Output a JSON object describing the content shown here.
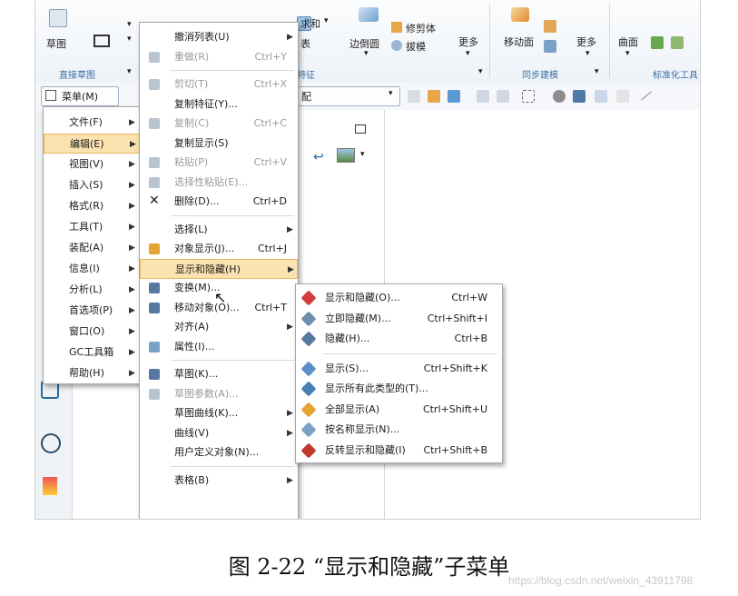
{
  "ribbon": {
    "sketch_label": "草图",
    "direct_sketch_label": "直接草图",
    "sum_label": "求和",
    "sum_sub": "表",
    "edge_label": "边倒圆",
    "trim_label": "修剪体",
    "draft_label": "拔模",
    "more1_label": "更多",
    "move_face_label": "移动面",
    "more2_label": "更多",
    "surface_label": "曲面",
    "feature_group": "特征",
    "sync_group": "同步建模",
    "std_group": "标准化工具"
  },
  "toolbar": {
    "menu_label": "菜单(M)",
    "assembly_combo": "配"
  },
  "main_menu": [
    {
      "label": "文件(F)"
    },
    {
      "label": "编辑(E)",
      "active": true
    },
    {
      "label": "视图(V)"
    },
    {
      "label": "插入(S)"
    },
    {
      "label": "格式(R)"
    },
    {
      "label": "工具(T)"
    },
    {
      "label": "装配(A)"
    },
    {
      "label": "信息(I)"
    },
    {
      "label": "分析(L)"
    },
    {
      "label": "首选项(P)"
    },
    {
      "label": "窗口(O)"
    },
    {
      "label": "GC工具箱"
    },
    {
      "label": "帮助(H)"
    }
  ],
  "edit_menu": [
    {
      "label": "撤消列表(U)",
      "shortcut": "",
      "submenu": true,
      "disabled": false
    },
    {
      "label": "重做(R)",
      "shortcut": "Ctrl+Y",
      "submenu": false,
      "disabled": true
    },
    {
      "sep": true
    },
    {
      "label": "剪切(T)",
      "shortcut": "Ctrl+X",
      "submenu": false,
      "disabled": true
    },
    {
      "label": "复制特征(Y)...",
      "shortcut": "",
      "submenu": false,
      "disabled": false
    },
    {
      "label": "复制(C)",
      "shortcut": "Ctrl+C",
      "submenu": false,
      "disabled": true
    },
    {
      "label": "复制显示(S)",
      "shortcut": "",
      "submenu": false,
      "disabled": false
    },
    {
      "label": "粘贴(P)",
      "shortcut": "Ctrl+V",
      "submenu": false,
      "disabled": true
    },
    {
      "label": "选择性粘贴(E)...",
      "shortcut": "",
      "submenu": false,
      "disabled": true
    },
    {
      "label": "删除(D)...",
      "shortcut": "Ctrl+D",
      "submenu": false,
      "disabled": false
    },
    {
      "sep": true
    },
    {
      "label": "选择(L)",
      "shortcut": "",
      "submenu": true,
      "disabled": false
    },
    {
      "label": "对象显示(J)...",
      "shortcut": "Ctrl+J",
      "submenu": false,
      "disabled": false
    },
    {
      "label": "显示和隐藏(H)",
      "shortcut": "",
      "submenu": true,
      "disabled": false,
      "active": true
    },
    {
      "label": "变换(M)...",
      "shortcut": "",
      "submenu": false,
      "disabled": false
    },
    {
      "label": "移动对象(O)...",
      "shortcut": "Ctrl+T",
      "submenu": false,
      "disabled": false
    },
    {
      "label": "对齐(A)",
      "shortcut": "",
      "submenu": true,
      "disabled": false
    },
    {
      "label": "属性(I)...",
      "shortcut": "",
      "submenu": false,
      "disabled": false
    },
    {
      "sep": true
    },
    {
      "label": "草图(K)...",
      "shortcut": "",
      "submenu": false,
      "disabled": false
    },
    {
      "label": "草图参数(A)...",
      "shortcut": "",
      "submenu": false,
      "disabled": true
    },
    {
      "label": "草图曲线(K)...",
      "shortcut": "",
      "submenu": true,
      "disabled": false
    },
    {
      "label": "曲线(V)",
      "shortcut": "",
      "submenu": true,
      "disabled": false
    },
    {
      "label": "用户定义对象(N)...",
      "shortcut": "",
      "submenu": false,
      "disabled": false
    },
    {
      "sep": true
    },
    {
      "label": "表格(B)",
      "shortcut": "",
      "submenu": true,
      "disabled": false
    }
  ],
  "show_hide_menu": [
    {
      "label": "显示和隐藏(O)...",
      "shortcut": "Ctrl+W"
    },
    {
      "label": "立即隐藏(M)...",
      "shortcut": "Ctrl+Shift+I"
    },
    {
      "label": "隐藏(H)...",
      "shortcut": "Ctrl+B"
    },
    {
      "sep": true
    },
    {
      "label": "显示(S)...",
      "shortcut": "Ctrl+Shift+K"
    },
    {
      "label": "显示所有此类型的(T)...",
      "shortcut": ""
    },
    {
      "label": "全部显示(A)",
      "shortcut": "Ctrl+Shift+U"
    },
    {
      "label": "按名称显示(N)...",
      "shortcut": ""
    },
    {
      "label": "反转显示和隐藏(I)",
      "shortcut": "Ctrl+Shift+B"
    }
  ],
  "caption": "图 2-22 “显示和隐藏”子菜单",
  "watermark": "https://blog.csdn.net/weixin_43911798",
  "colors": {
    "highlight_bg": "#fbe3b0",
    "highlight_border": "#e8b85e",
    "group_label": "#3a6ea8"
  }
}
